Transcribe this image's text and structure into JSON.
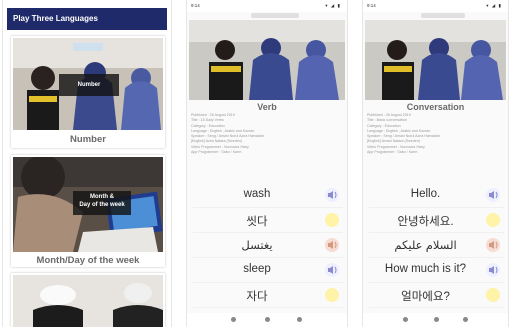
{
  "app": {
    "title": "Play Three Languages"
  },
  "home": {
    "cards": [
      {
        "caption": "Number",
        "overlay": "Number"
      },
      {
        "caption": "Month/Day of the week",
        "overlay": "Month &\nDay of the week"
      },
      {
        "caption": "",
        "overlay": ""
      }
    ]
  },
  "verb": {
    "title": "Verb",
    "meta": [
      "Published : 26 August 2019",
      "Title : 15 Daily Verbs",
      "Category : Education",
      "Language : English , Arabic and Korean",
      "Speaker : Seng / Amani Nurul Azira Hamadah",
      "[English] Azira Natara (Sweden)",
      "Video Programmer : Nouruazz Hany",
      "App Programmer : Sabu / Karm"
    ],
    "rows": [
      {
        "word": "wash",
        "button": "speaker-icon"
      },
      {
        "word": "씻다",
        "button": "yellow"
      },
      {
        "word": "يغتسل",
        "button": "red"
      },
      {
        "word": "sleep",
        "button": "speaker-icon"
      },
      {
        "word": "자다",
        "button": "yellow"
      }
    ]
  },
  "conversation": {
    "title": "Conversation",
    "meta": [
      "Published : 26 August 2019",
      "Title : Basic conversation",
      "Category : Education",
      "Language : English , Arabic and Korean",
      "Speaker : Seng / Amani Nurul Azira Hamadah",
      "[English] Amani Natara (Sweden)",
      "Video Programmer : Nouruazz Hany",
      "App Programmer : Sabu / Karm"
    ],
    "rows": [
      {
        "word": "Hello.",
        "button": "speaker-icon"
      },
      {
        "word": "안녕하세요.",
        "button": "yellow"
      },
      {
        "word": "السلام عليكم",
        "button": "red"
      },
      {
        "word": "How much is it?",
        "button": "speaker-icon"
      },
      {
        "word": "얼마에요?",
        "button": "yellow"
      }
    ]
  },
  "status": {
    "time": "9:14",
    "icons": "▾ ◢ ▮"
  }
}
